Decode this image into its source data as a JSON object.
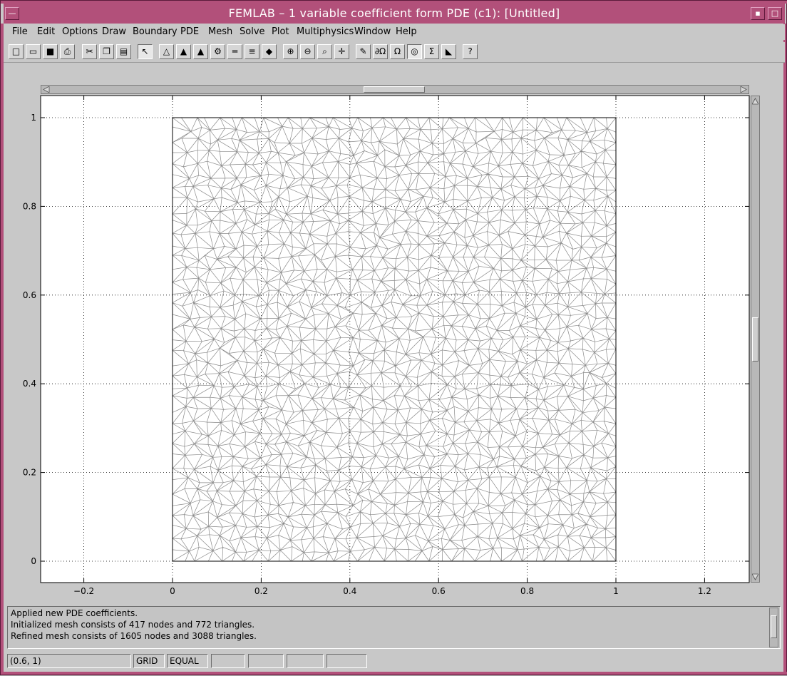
{
  "window": {
    "title": "FEMLAB – 1 variable coefficient form PDE (c1): [Untitled]",
    "accent_color": "#b2507a"
  },
  "menubar": {
    "items": [
      {
        "label": "File"
      },
      {
        "label": "Edit"
      },
      {
        "label": "Options"
      },
      {
        "label": "Draw"
      },
      {
        "label": "Boundary"
      },
      {
        "label": "PDE"
      },
      {
        "label": "Mesh"
      },
      {
        "label": "Solve"
      },
      {
        "label": "Plot"
      },
      {
        "label": "Multiphysics"
      },
      {
        "label": "Window"
      },
      {
        "label": "Help"
      }
    ]
  },
  "toolbar": {
    "tools": [
      {
        "name": "new-icon",
        "glyph": "□"
      },
      {
        "name": "open-icon",
        "glyph": "▭"
      },
      {
        "name": "save-icon",
        "glyph": "■"
      },
      {
        "name": "print-icon",
        "glyph": "⎙"
      },
      {
        "name": "cut-icon",
        "glyph": "✂"
      },
      {
        "name": "copy-icon",
        "glyph": "❐"
      },
      {
        "name": "paste-icon",
        "glyph": "▤"
      },
      {
        "name": "pointer-icon",
        "glyph": "↖"
      },
      {
        "name": "boundary-mode-icon",
        "glyph": "△"
      },
      {
        "name": "subdomain-mode-icon",
        "glyph": "▲"
      },
      {
        "name": "init-mesh-icon",
        "glyph": "▲"
      },
      {
        "name": "refine-mesh-icon",
        "glyph": "⚙"
      },
      {
        "name": "equals-icon",
        "glyph": "═"
      },
      {
        "name": "solve-icon",
        "glyph": "≡"
      },
      {
        "name": "plot-icon",
        "glyph": "◆"
      },
      {
        "name": "zoom-in-icon",
        "glyph": "⊕"
      },
      {
        "name": "zoom-out-icon",
        "glyph": "⊖"
      },
      {
        "name": "zoom-window-icon",
        "glyph": "⌕"
      },
      {
        "name": "zoom-extents-icon",
        "glyph": "✛"
      },
      {
        "name": "edit-icon",
        "glyph": "✎"
      },
      {
        "name": "boundary-settings-icon",
        "glyph": "∂Ω"
      },
      {
        "name": "subdomain-settings-icon",
        "glyph": "Ω"
      },
      {
        "name": "mesh-mode-icon",
        "glyph": "◎"
      },
      {
        "name": "sum-icon",
        "glyph": "Σ"
      },
      {
        "name": "plot-parameters-icon",
        "glyph": "◣"
      },
      {
        "name": "help-icon",
        "glyph": "?"
      }
    ]
  },
  "plot": {
    "x_ticks": [
      "−0.2",
      "0",
      "0.2",
      "0.4",
      "0.6",
      "0.8",
      "1",
      "1.2"
    ],
    "y_ticks": [
      "0",
      "0.2",
      "0.4",
      "0.6",
      "0.8",
      "1"
    ],
    "grid": true,
    "domain": "unit square mesh",
    "xlim": [
      -0.3,
      1.3
    ],
    "ylim": [
      -0.05,
      1.05
    ]
  },
  "messages": {
    "lines": [
      "Applied new PDE coefficients.",
      "Initialized mesh consists of 417 nodes and 772 triangles.",
      "Refined mesh consists of 1605 nodes and 3088 triangles."
    ]
  },
  "status": {
    "coords": "(0.6, 1)",
    "grid": "GRID",
    "equal": "EQUAL"
  }
}
